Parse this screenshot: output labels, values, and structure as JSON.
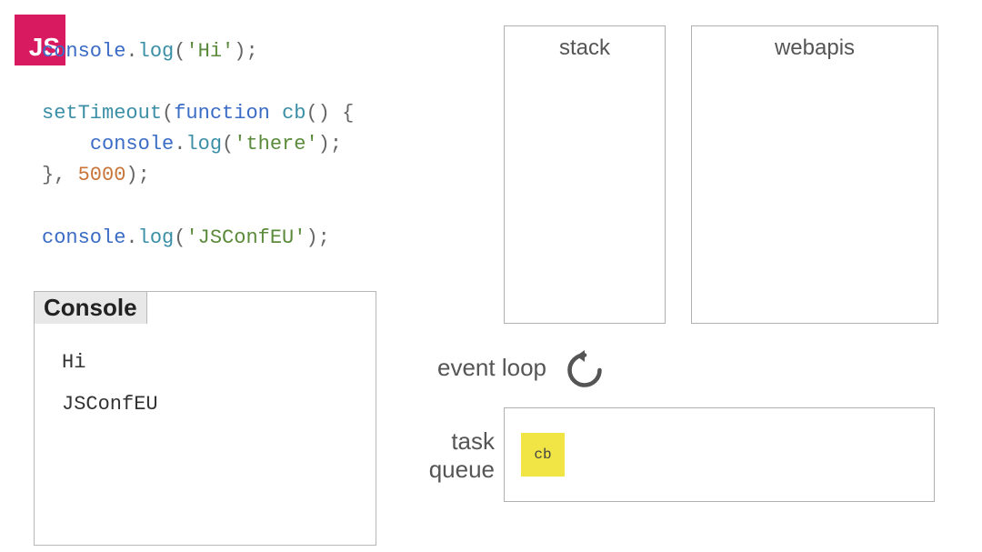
{
  "logo": "JS",
  "code": {
    "line1": {
      "t1": "console",
      "t2": ".",
      "t3": "log",
      "t4": "(",
      "t5": "'Hi'",
      "t6": ");"
    },
    "line2": {
      "t1": "setTimeout",
      "t2": "(",
      "t3": "function",
      "t4": " ",
      "t5": "cb",
      "t6": "() {"
    },
    "line3": {
      "indent": "    ",
      "t1": "console",
      "t2": ".",
      "t3": "log",
      "t4": "(",
      "t5": "'there'",
      "t6": ");"
    },
    "line4": {
      "t1": "}, ",
      "t2": "5000",
      "t3": ");"
    },
    "line5": {
      "t1": "console",
      "t2": ".",
      "t3": "log",
      "t4": "(",
      "t5": "'JSConfEU'",
      "t6": ");"
    }
  },
  "console": {
    "title": "Console",
    "output": [
      "Hi",
      "JSConfEU"
    ]
  },
  "stack": {
    "title": "stack"
  },
  "webapis": {
    "title": "webapis"
  },
  "event_loop": {
    "label": "event loop"
  },
  "task_queue": {
    "label": "task\nqueue",
    "items": [
      "cb"
    ]
  }
}
